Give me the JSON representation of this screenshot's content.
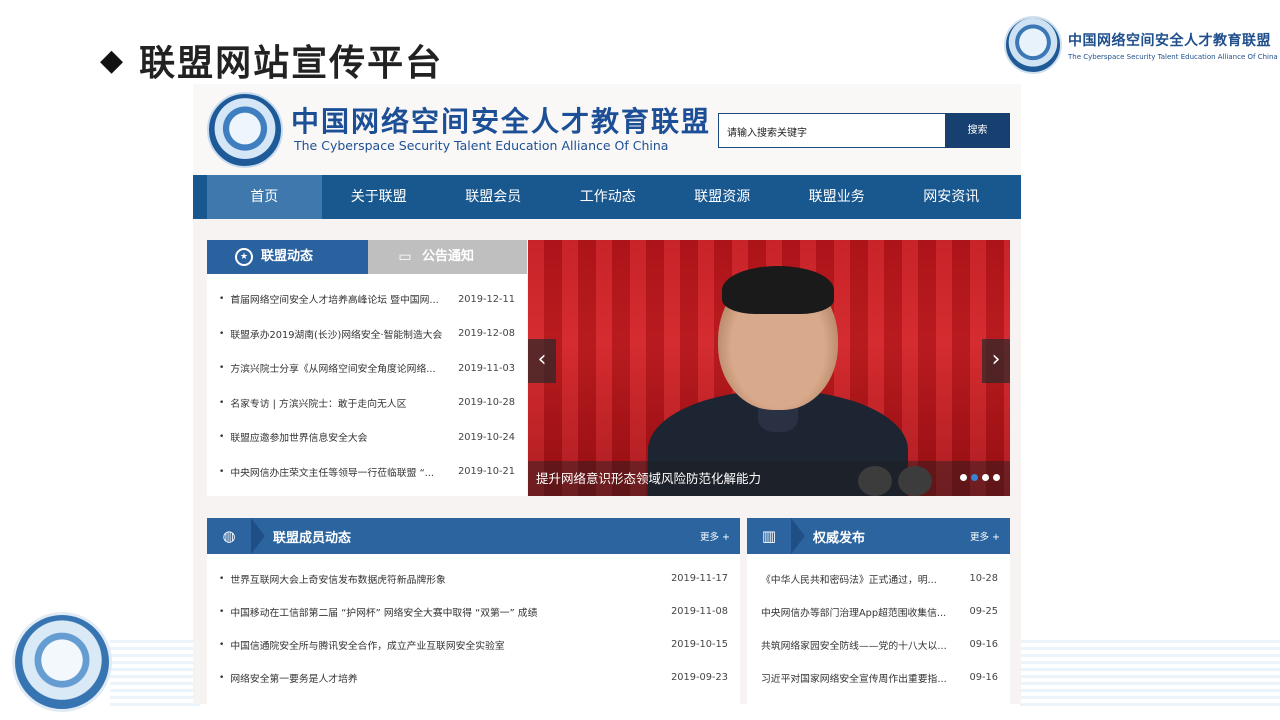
{
  "slide": {
    "title": "联盟网站宣传平台",
    "brand_cn": "中国网络空间安全人才教育联盟",
    "brand_en": "The Cyberspace Security Talent Education Alliance Of China"
  },
  "site": {
    "logo_cn": "中国网络空间安全人才教育联盟",
    "logo_en": "The Cyberspace Security Talent Education Alliance Of China",
    "search_placeholder": "请输入搜索关键字",
    "search_button": "搜索",
    "nav": [
      "首页",
      "关于联盟",
      "联盟会员",
      "工作动态",
      "联盟资源",
      "联盟业务",
      "网安资讯"
    ],
    "tabs": [
      "联盟动态",
      "公告通知"
    ],
    "news": [
      {
        "title": "首届网络空间安全人才培养高峰论坛 暨中国网...",
        "date": "2019-12-11"
      },
      {
        "title": "联盟承办2019湖南(长沙)网络安全·智能制造大会",
        "date": "2019-12-08"
      },
      {
        "title": "方滨兴院士分享《从网络空间安全角度论网络...",
        "date": "2019-11-03"
      },
      {
        "title": "名家专访 | 方滨兴院士：敢于走向无人区",
        "date": "2019-10-28"
      },
      {
        "title": "联盟应邀参加世界信息安全大会",
        "date": "2019-10-24"
      },
      {
        "title": "中央网信办庄荣文主任等领导一行莅临联盟 “...",
        "date": "2019-10-21"
      }
    ],
    "slider": {
      "caption": "提升网络意识形态领域风险防范化解能力",
      "prev": "‹",
      "next": "›",
      "dots_total": 4,
      "dots_active": 2
    },
    "members_panel": {
      "title": "联盟成员动态",
      "more": "更多 +",
      "items": [
        {
          "title": "世界互联网大会上奇安信发布数据虎符新品牌形象",
          "date": "2019-11-17"
        },
        {
          "title": "中国移动在工信部第二届 “护网杯” 网络安全大赛中取得 “双第一” 成绩",
          "date": "2019-11-08"
        },
        {
          "title": "中国信通院安全所与腾讯安全合作，成立产业互联网安全实验室",
          "date": "2019-10-15"
        },
        {
          "title": "网络安全第一要务是人才培养",
          "date": "2019-09-23"
        }
      ]
    },
    "authority_panel": {
      "title": "权威发布",
      "more": "更多 +",
      "items": [
        {
          "title": "《中华人民共和密码法》正式通过，明...",
          "date": "10-28"
        },
        {
          "title": "中央网信办等部门治理App超范围收集信...",
          "date": "09-25"
        },
        {
          "title": "共筑网络家园安全防线——党的十八大以...",
          "date": "09-16"
        },
        {
          "title": "习近平对国家网络安全宣传周作出重要指...",
          "date": "09-16"
        }
      ]
    }
  },
  "colors": {
    "nav_bg": "#19578f",
    "nav_active": "#3f78ad",
    "panel_head": "#2b649f",
    "search_button": "#173f70",
    "slider_red": "#c4161c"
  }
}
